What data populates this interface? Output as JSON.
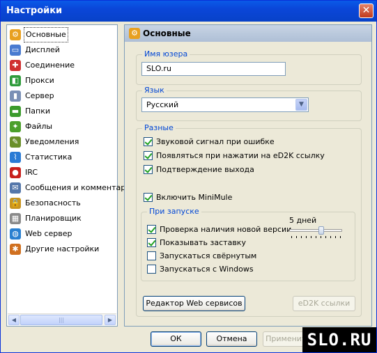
{
  "window": {
    "title": "Настройки",
    "close_glyph": "✕"
  },
  "sidebar": {
    "items": [
      {
        "label": "Основные",
        "icon": "gear-icon",
        "glyph": "⚙",
        "color": "#e8a020"
      },
      {
        "label": "Дисплей",
        "icon": "monitor-icon",
        "glyph": "▭",
        "color": "#4a7bd0"
      },
      {
        "label": "Соединение",
        "icon": "network-icon",
        "glyph": "✚",
        "color": "#d03030"
      },
      {
        "label": "Прокси",
        "icon": "proxy-icon",
        "glyph": "◧",
        "color": "#2e9b3a"
      },
      {
        "label": "Сервер",
        "icon": "server-icon",
        "glyph": "▮",
        "color": "#7a8fb5"
      },
      {
        "label": "Папки",
        "icon": "folder-icon",
        "glyph": "▬",
        "color": "#3b9b2c"
      },
      {
        "label": "Файлы",
        "icon": "files-icon",
        "glyph": "✦",
        "color": "#4ca02c"
      },
      {
        "label": "Уведомления",
        "icon": "notification-icon",
        "glyph": "✎",
        "color": "#6a8f2a"
      },
      {
        "label": "Статистика",
        "icon": "statistics-icon",
        "glyph": "⌇",
        "color": "#2a7bd5"
      },
      {
        "label": "IRC",
        "icon": "irc-icon",
        "glyph": "●",
        "color": "#c8201c"
      },
      {
        "label": "Сообщения и комментарии",
        "icon": "messages-icon",
        "glyph": "✉",
        "color": "#5577aa"
      },
      {
        "label": "Безопасность",
        "icon": "lock-icon",
        "glyph": "🔒",
        "color": "#c89420"
      },
      {
        "label": "Планировщик",
        "icon": "calendar-icon",
        "glyph": "▦",
        "color": "#8a8a8a"
      },
      {
        "label": "Web сервер",
        "icon": "globe-icon",
        "glyph": "◍",
        "color": "#2a80d0"
      },
      {
        "label": "Другие настройки",
        "icon": "settings-icon",
        "glyph": "✱",
        "color": "#d07020"
      }
    ],
    "selected_index": 0
  },
  "panel": {
    "title": "Основные",
    "username": {
      "legend": "Имя юзера",
      "value": "SLO.ru"
    },
    "language": {
      "legend": "Язык",
      "value": "Русский"
    },
    "misc": {
      "legend": "Разные",
      "options": [
        {
          "label": "Звуковой сигнал при ошибке",
          "checked": true
        },
        {
          "label": "Появляться при нажатии на eD2K ссылку",
          "checked": true
        },
        {
          "label": "Подтверждение выхода",
          "checked": true
        }
      ],
      "minimule": {
        "label": "Включить MiniMule",
        "checked": true
      }
    },
    "startup": {
      "legend": "При запуске",
      "options": [
        {
          "label": "Проверка наличия новой версии",
          "checked": true
        },
        {
          "label": "Показывать заставку",
          "checked": true
        },
        {
          "label": "Запускаться свёрнутым",
          "checked": false
        },
        {
          "label": "Запускаться с Windows",
          "checked": false
        }
      ],
      "slider_label": "5 дней",
      "slider_fraction": 0.6
    },
    "web_editor_button": "Редактор Web сервисов",
    "ed2k_links_button": "eD2K ссылки"
  },
  "footer": {
    "ok": "ОК",
    "cancel": "Отмена",
    "apply": "Применить"
  },
  "watermark": "SLO.RU"
}
